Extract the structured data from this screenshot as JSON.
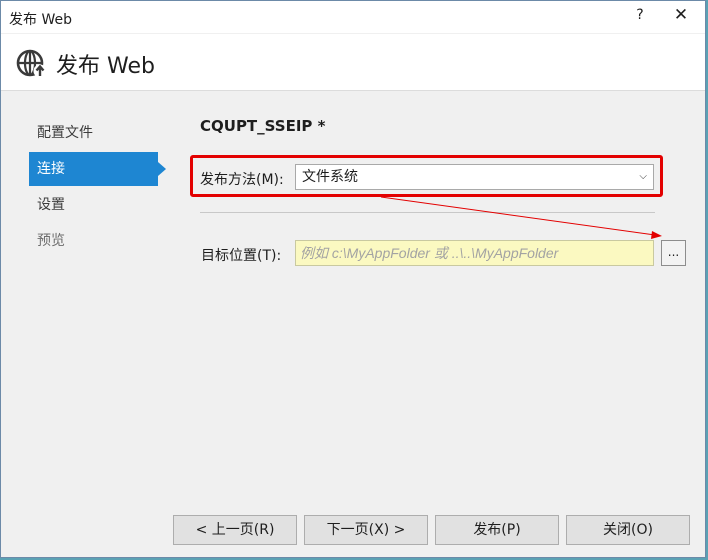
{
  "window": {
    "title": "发布 Web",
    "help_label": "?",
    "close_label": "✕"
  },
  "header": {
    "title": "发布 Web",
    "icon": "globe-publish-icon"
  },
  "nav": {
    "items": [
      {
        "label": "配置文件",
        "state": "normal"
      },
      {
        "label": "连接",
        "state": "active"
      },
      {
        "label": "设置",
        "state": "normal"
      },
      {
        "label": "预览",
        "state": "disabled"
      }
    ]
  },
  "main": {
    "profile_name": "CQUPT_SSEIP *",
    "method_label": "发布方法(M):",
    "method_value": "文件系统",
    "target_label": "目标位置(T):",
    "target_placeholder": "例如 c:\\MyAppFolder 或 ..\\..\\MyAppFolder",
    "browse_label": "..."
  },
  "buttons": {
    "prev": "< 上一页(R)",
    "next": "下一页(X) >",
    "publish": "发布(P)",
    "close": "关闭(O)"
  },
  "colors": {
    "accent": "#1e86d2",
    "highlight": "#e30000",
    "input_bg": "#fbf9c1"
  }
}
